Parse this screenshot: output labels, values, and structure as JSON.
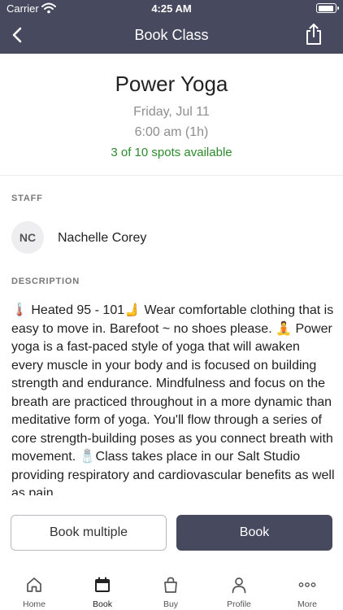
{
  "status_bar": {
    "carrier": "Carrier",
    "time": "4:25 AM"
  },
  "nav": {
    "title": "Book Class",
    "back_icon": "chevron-left-icon",
    "share_icon": "share-icon"
  },
  "class_info": {
    "name": "Power Yoga",
    "date": "Friday, Jul 11",
    "time": "6:00 am (1h)",
    "spots": "3 of 10 spots available"
  },
  "staff": {
    "label": "STAFF",
    "initials": "NC",
    "name": "Nachelle Corey"
  },
  "description": {
    "label": "DESCRIPTION",
    "text": "🌡️ Heated 95 - 101🫸 Wear comfortable clothing that is easy to move in. Barefoot ~ no shoes please. 🧘 Power yoga is a fast-paced style of yoga that will awaken every muscle in your body and is focused on building strength and endurance. Mindfulness and focus on the breath are practiced throughout in a more dynamic than meditative form of yoga. You'll flow through a series of core strength-building poses as you connect breath with movement. 🧂Class takes place in our Salt Studio providing respiratory and cardiovascular benefits as well as pain"
  },
  "actions": {
    "book_multiple": "Book multiple",
    "book": "Book"
  },
  "tabs": [
    {
      "label": "Home",
      "icon": "home-icon"
    },
    {
      "label": "Book",
      "icon": "calendar-icon",
      "active": true
    },
    {
      "label": "Buy",
      "icon": "shopping-bag-icon"
    },
    {
      "label": "Profile",
      "icon": "person-icon"
    },
    {
      "label": "More",
      "icon": "more-dots-icon"
    }
  ],
  "colors": {
    "nav_background": "#474a5e",
    "spots_available": "#2c8a2c",
    "primary_button": "#474a5e"
  }
}
